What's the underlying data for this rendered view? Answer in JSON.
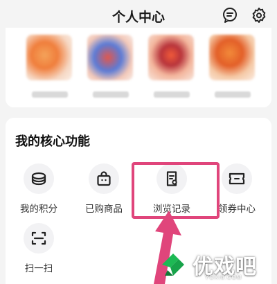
{
  "header": {
    "title": "个人中心",
    "message_icon": "message-bubble-icon",
    "settings_icon": "gear-icon"
  },
  "core_functions": {
    "title": "我的核心功能",
    "items": [
      {
        "label": "我的积分",
        "icon": "coin-stack-icon"
      },
      {
        "label": "已购商品",
        "icon": "shopping-bag-icon"
      },
      {
        "label": "浏览记录",
        "icon": "browse-history-icon"
      },
      {
        "label": "领券中心",
        "icon": "coupon-ticket-icon"
      },
      {
        "label": "扫一扫",
        "icon": "scan-icon"
      }
    ]
  },
  "watermark": {
    "text": "优戏吧",
    "url": "YOXI8.COM"
  },
  "colors": {
    "accent_highlight": "#e0457b",
    "arrow": "#e0457b",
    "background": "#f4f4f4",
    "card": "#ffffff"
  }
}
